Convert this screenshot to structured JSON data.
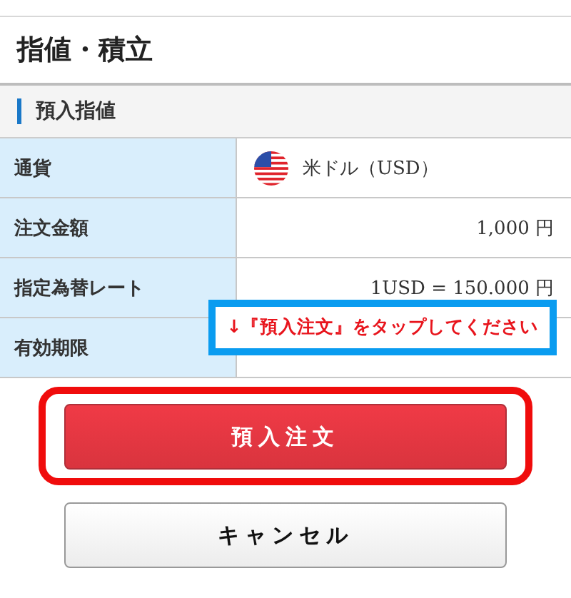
{
  "page_title": "指値・積立",
  "section": {
    "title": "預入指値"
  },
  "rows": [
    {
      "label": "通貨",
      "kind": "currency",
      "value": "米ドル（USD）"
    },
    {
      "label": "注文金額",
      "kind": "text",
      "value": "1,000 円"
    },
    {
      "label": "指定為替レート",
      "kind": "text",
      "value": "1USD = 150.000 円"
    },
    {
      "label": "有効期限",
      "kind": "text"
    }
  ],
  "callout": {
    "text": "↓『預入注文』をタップしてください"
  },
  "buttons": [
    {
      "label": "預入注文",
      "kind": "primary",
      "highlighted": true
    },
    {
      "label": "キャンセル",
      "kind": "secondary",
      "highlighted": false
    }
  ]
}
